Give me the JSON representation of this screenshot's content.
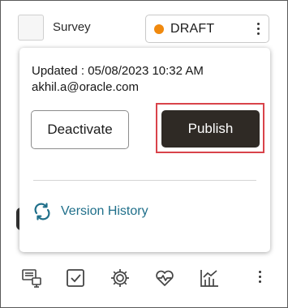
{
  "header": {
    "title": "Survey",
    "status": {
      "label": "DRAFT",
      "dot_color": "#f0890e",
      "menu_icon": "kebab-vertical-icon"
    }
  },
  "popup": {
    "updated": "Updated : 05/08/2023 10:32 AM",
    "email": "akhil.a@oracle.com",
    "deactivate_label": "Deactivate",
    "publish_label": "Publish",
    "publish_bg": "#2f2a25",
    "highlight_color": "#d9434a",
    "version_history_label": "Version History",
    "link_color": "#1f6f8a"
  },
  "toolbar": {
    "icons": [
      "monitor-icon",
      "checkbox-icon",
      "gear-icon",
      "heart-pulse-icon",
      "chart-icon",
      "kebab-vertical-icon"
    ]
  }
}
